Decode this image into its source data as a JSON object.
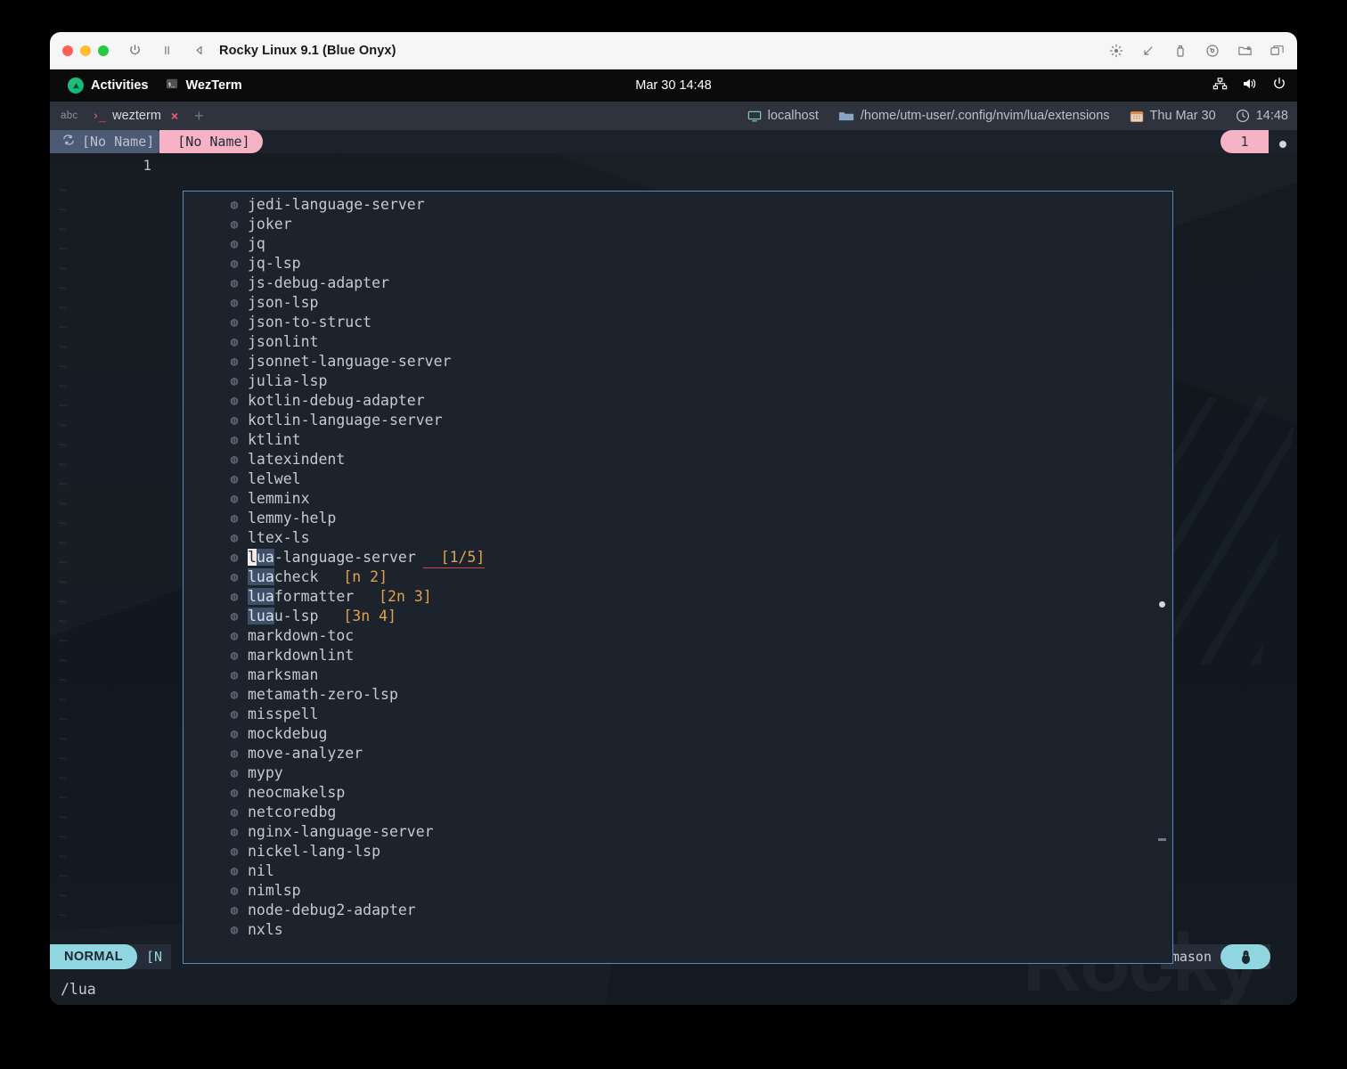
{
  "window": {
    "title": "Rocky Linux 9.1 (Blue Onyx)",
    "traffic": [
      "close",
      "minimize",
      "zoom"
    ],
    "left_icons": [
      "power-icon",
      "pause-icon",
      "back-icon"
    ],
    "right_icons": [
      "brightness-icon",
      "resize-icon",
      "usb-icon",
      "disc-icon",
      "shared-folder-icon",
      "windows-icon"
    ]
  },
  "gnome": {
    "activities": "Activities",
    "app": "WezTerm",
    "clock": "Mar 30  14:48",
    "right_icons": [
      "network-icon",
      "volume-icon",
      "power-icon"
    ]
  },
  "wezterm": {
    "abc_label": "abc",
    "tab_title": "wezterm",
    "tab_prompt": "›_",
    "close_label": "×",
    "new_tab_label": "+",
    "status": {
      "host_icon": "display-icon",
      "host": "localhost",
      "folder_icon": "folder-icon",
      "path": "/home/utm-user/.config/nvim/lua/extensions",
      "calendar_icon": "calendar-icon",
      "date": "Thu Mar 30",
      "clock_icon": "clock-icon",
      "time": "14:48"
    }
  },
  "bufferline": {
    "buffers": [
      {
        "icon": "",
        "label": "[No Name]",
        "active": false
      },
      {
        "icon": "",
        "label": "[No Name]",
        "active": true
      }
    ],
    "count": "1"
  },
  "editor": {
    "line_number": "1",
    "statusline": {
      "mode": "NORMAL",
      "buffer_clipped": "[N",
      "right_label": "mason",
      "right_icon": "linux-tux-icon"
    },
    "cmdline": "/lua"
  },
  "popup": {
    "bullet_icon": "◍",
    "items": [
      {
        "name": "jedi-language-server"
      },
      {
        "name": "joker"
      },
      {
        "name": "jq"
      },
      {
        "name": "jq-lsp"
      },
      {
        "name": "js-debug-adapter"
      },
      {
        "name": "json-lsp"
      },
      {
        "name": "json-to-struct"
      },
      {
        "name": "jsonlint"
      },
      {
        "name": "jsonnet-language-server"
      },
      {
        "name": "julia-lsp"
      },
      {
        "name": "kotlin-debug-adapter"
      },
      {
        "name": "kotlin-language-server"
      },
      {
        "name": "ktlint"
      },
      {
        "name": "latexindent"
      },
      {
        "name": "lelwel"
      },
      {
        "name": "lemminx"
      },
      {
        "name": "lemmy-help"
      },
      {
        "name": "ltex-ls"
      },
      {
        "name": "lua-language-server",
        "match": "lua",
        "cursor": "l",
        "count": "[1/5]",
        "count_underline": true
      },
      {
        "name": "luacheck",
        "match": "lua",
        "count": "[n 2]"
      },
      {
        "name": "luaformatter",
        "match": "lua",
        "count": "[2n 3]"
      },
      {
        "name": "luau-lsp",
        "match": "lua",
        "count": "[3n 4]"
      },
      {
        "name": "markdown-toc"
      },
      {
        "name": "markdownlint"
      },
      {
        "name": "marksman"
      },
      {
        "name": "metamath-zero-lsp"
      },
      {
        "name": "misspell"
      },
      {
        "name": "mockdebug"
      },
      {
        "name": "move-analyzer"
      },
      {
        "name": "mypy"
      },
      {
        "name": "neocmakelsp"
      },
      {
        "name": "netcoredbg"
      },
      {
        "name": "nginx-language-server"
      },
      {
        "name": "nickel-lang-lsp"
      },
      {
        "name": "nil"
      },
      {
        "name": "nimlsp"
      },
      {
        "name": "node-debug2-adapter"
      },
      {
        "name": "nxls"
      }
    ]
  },
  "colors": {
    "accent_pink": "#f7b3c6",
    "accent_cyan": "#8fd6e0",
    "popup_border": "#5a87bd",
    "search_hl": "#3f5068",
    "count_orange": "#e0a24a",
    "terminal_bg": "#161b22"
  }
}
